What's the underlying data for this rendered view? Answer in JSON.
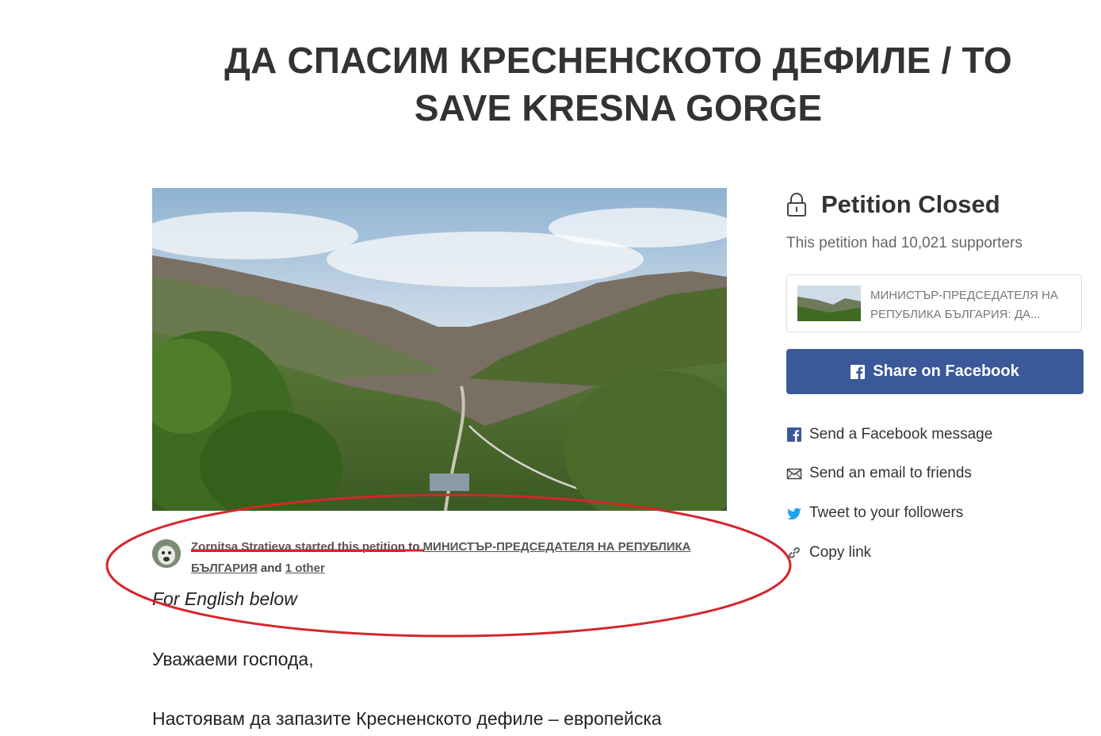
{
  "petition": {
    "title_line1": "ДА СПАСИМ КРЕСНЕНСКОТО ДЕФИЛЕ / TO",
    "title_line2": "SAVE KRESNA GORGE",
    "starter_name_action": "Zornitsa Stratieva started this petition",
    "starter_to": " to ",
    "recipient": "МИНИСТЪР-ПРЕДСЕДАТЕЛЯ НА РЕПУБЛИКА БЪЛГАРИЯ",
    "and_text": " and ",
    "others": "1 other",
    "english_note": "For English below",
    "paragraph1": "Уважаеми господа,",
    "paragraph2": "Настоявам да запазите Кресненското дефиле – европейска"
  },
  "sidebar": {
    "status": "Petition Closed",
    "supporters_text": "This petition had 10,021 supporters",
    "card_text": "МИНИСТЪР-ПРЕДСЕДАТЕЛЯ НА РЕПУБЛИКА БЪЛГАРИЯ: ДА...",
    "facebook_button": "Share on Facebook",
    "share_items": [
      {
        "label": "Send a Facebook message",
        "icon": "facebook-icon"
      },
      {
        "label": "Send an email to friends",
        "icon": "envelope-icon"
      },
      {
        "label": "Tweet to your followers",
        "icon": "twitter-icon"
      },
      {
        "label": "Copy link",
        "icon": "link-icon"
      }
    ]
  },
  "colors": {
    "facebook_blue": "#3b5998",
    "annotation_red": "#d4262c",
    "title_text": "#333333"
  }
}
